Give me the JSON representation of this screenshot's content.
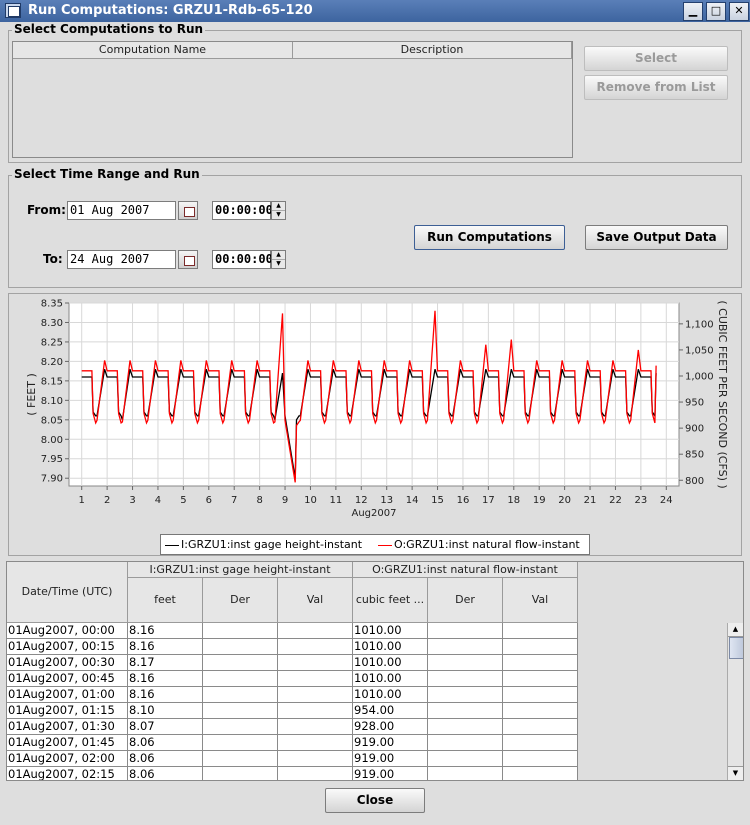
{
  "window": {
    "title": "Run Computations: GRZU1-Rdb-65-120",
    "minimize_glyph": "▁",
    "maximize_glyph": "□",
    "close_glyph": "✕"
  },
  "select_section": {
    "legend": "Select Computations to Run",
    "columns": [
      "Computation Name",
      "Description"
    ],
    "select_button": "Select",
    "remove_button": "Remove from List"
  },
  "time_section": {
    "legend": "Select Time Range and Run",
    "from_label": "From:",
    "from_date": "01 Aug 2007",
    "from_time": "00:00:00",
    "to_label": "To:",
    "to_date": "24 Aug 2007",
    "to_time": "00:00:00",
    "run_button": "Run Computations",
    "save_button": "Save Output Data"
  },
  "chart_data": {
    "type": "line",
    "title": "",
    "xlabel": "Aug2007",
    "ylabel": "( FEET )",
    "y2label": "( CUBIC FEET PER SECOND (CFS) )",
    "x_ticks": [
      "1",
      "2",
      "3",
      "4",
      "5",
      "6",
      "7",
      "8",
      "9",
      "10",
      "11",
      "12",
      "13",
      "14",
      "15",
      "16",
      "17",
      "18",
      "19",
      "20",
      "21",
      "22",
      "23",
      "24"
    ],
    "xlim": [
      0.5,
      24.5
    ],
    "ylim": [
      7.88,
      8.35
    ],
    "y_ticks": [
      "7.90",
      "7.95",
      "8.00",
      "8.05",
      "8.10",
      "8.15",
      "8.20",
      "8.25",
      "8.30",
      "8.35"
    ],
    "y2lim": [
      789,
      1140
    ],
    "y2_ticks": [
      "800",
      "850",
      "900",
      "950",
      "1,000",
      "1,050",
      "1,100"
    ],
    "grid": true,
    "legend_position": "bottom",
    "series": [
      {
        "name": "I:GRZU1:inst gage height-instant",
        "color": "#000000",
        "axis": "left",
        "x": [
          1.0,
          1.4,
          1.45,
          1.55,
          1.6,
          1.9,
          2.0,
          2.4,
          2.45,
          2.55,
          2.6,
          2.9,
          3.0,
          3.4,
          3.45,
          3.55,
          3.6,
          3.9,
          4.0,
          4.4,
          4.45,
          4.55,
          4.6,
          4.9,
          5.0,
          5.4,
          5.45,
          5.55,
          5.6,
          5.9,
          6.0,
          6.4,
          6.45,
          6.55,
          6.6,
          6.9,
          7.0,
          7.4,
          7.45,
          7.55,
          7.6,
          7.9,
          8.0,
          8.4,
          8.45,
          8.55,
          8.6,
          8.9,
          9.0,
          9.4,
          9.45,
          9.55,
          9.6,
          9.9,
          10.0,
          10.4,
          10.45,
          10.55,
          10.6,
          10.9,
          11.0,
          11.4,
          11.45,
          11.55,
          11.6,
          11.9,
          12.0,
          12.4,
          12.45,
          12.55,
          12.6,
          12.9,
          13.0,
          13.4,
          13.45,
          13.55,
          13.6,
          13.9,
          14.0,
          14.4,
          14.45,
          14.55,
          14.6,
          14.9,
          15.0,
          15.4,
          15.45,
          15.55,
          15.6,
          15.9,
          16.0,
          16.4,
          16.45,
          16.55,
          16.6,
          16.9,
          17.0,
          17.4,
          17.45,
          17.55,
          17.6,
          17.9,
          18.0,
          18.4,
          18.45,
          18.55,
          18.6,
          18.9,
          19.0,
          19.4,
          19.45,
          19.55,
          19.6,
          19.9,
          20.0,
          20.4,
          20.45,
          20.55,
          20.6,
          20.9,
          21.0,
          21.4,
          21.45,
          21.55,
          21.6,
          21.9,
          22.0,
          22.4,
          22.45,
          22.55,
          22.6,
          22.9,
          23.0,
          23.4,
          23.45,
          23.55,
          23.6
        ],
        "y": [
          8.16,
          8.16,
          8.07,
          8.06,
          8.06,
          8.18,
          8.16,
          8.16,
          8.07,
          8.06,
          8.05,
          8.18,
          8.16,
          8.16,
          8.07,
          8.06,
          8.06,
          8.18,
          8.16,
          8.16,
          8.07,
          8.06,
          8.06,
          8.18,
          8.16,
          8.16,
          8.07,
          8.06,
          8.06,
          8.18,
          8.16,
          8.16,
          8.07,
          8.06,
          8.06,
          8.18,
          8.16,
          8.16,
          8.07,
          8.06,
          8.06,
          8.18,
          8.16,
          8.16,
          8.07,
          8.06,
          8.05,
          8.17,
          8.06,
          7.9,
          8.05,
          8.06,
          8.06,
          8.18,
          8.16,
          8.16,
          8.07,
          8.06,
          8.06,
          8.18,
          8.16,
          8.16,
          8.07,
          8.06,
          8.06,
          8.18,
          8.16,
          8.16,
          8.07,
          8.06,
          8.06,
          8.18,
          8.16,
          8.16,
          8.07,
          8.06,
          8.06,
          8.18,
          8.16,
          8.16,
          8.07,
          8.06,
          8.06,
          8.18,
          8.16,
          8.16,
          8.07,
          8.06,
          8.06,
          8.18,
          8.16,
          8.16,
          8.07,
          8.06,
          8.06,
          8.18,
          8.16,
          8.16,
          8.07,
          8.06,
          8.06,
          8.18,
          8.16,
          8.16,
          8.07,
          8.06,
          8.06,
          8.18,
          8.16,
          8.16,
          8.07,
          8.06,
          8.06,
          8.18,
          8.16,
          8.16,
          8.07,
          8.06,
          8.06,
          8.18,
          8.16,
          8.16,
          8.07,
          8.06,
          8.06,
          8.18,
          8.16,
          8.16,
          8.07,
          8.06,
          8.06,
          8.18,
          8.16,
          8.16,
          8.07,
          8.06,
          8.17
        ]
      },
      {
        "name": "O:GRZU1:inst natural flow-instant",
        "color": "#ff0000",
        "axis": "right",
        "x": [
          1.0,
          1.4,
          1.45,
          1.55,
          1.6,
          1.9,
          2.0,
          2.4,
          2.45,
          2.55,
          2.6,
          2.9,
          3.0,
          3.4,
          3.45,
          3.55,
          3.6,
          3.9,
          4.0,
          4.4,
          4.45,
          4.55,
          4.6,
          4.9,
          5.0,
          5.4,
          5.45,
          5.55,
          5.6,
          5.9,
          6.0,
          6.4,
          6.45,
          6.55,
          6.6,
          6.9,
          7.0,
          7.4,
          7.45,
          7.55,
          7.6,
          7.9,
          8.0,
          8.4,
          8.45,
          8.55,
          8.6,
          8.9,
          9.0,
          9.4,
          9.45,
          9.55,
          9.6,
          9.9,
          10.0,
          10.4,
          10.45,
          10.55,
          10.6,
          10.9,
          11.0,
          11.4,
          11.45,
          11.55,
          11.6,
          11.9,
          12.0,
          12.4,
          12.45,
          12.55,
          12.6,
          12.9,
          13.0,
          13.4,
          13.45,
          13.55,
          13.6,
          13.9,
          14.0,
          14.4,
          14.45,
          14.55,
          14.6,
          14.9,
          15.0,
          15.4,
          15.45,
          15.55,
          15.6,
          15.9,
          16.0,
          16.4,
          16.45,
          16.55,
          16.6,
          16.9,
          17.0,
          17.4,
          17.45,
          17.55,
          17.6,
          17.9,
          18.0,
          18.4,
          18.45,
          18.55,
          18.6,
          18.9,
          19.0,
          19.4,
          19.45,
          19.55,
          19.6,
          19.9,
          20.0,
          20.4,
          20.45,
          20.55,
          20.6,
          20.9,
          21.0,
          21.4,
          21.45,
          21.55,
          21.6,
          21.9,
          22.0,
          22.4,
          22.45,
          22.55,
          22.6,
          22.9,
          23.0,
          23.4,
          23.45,
          23.55,
          23.6
        ],
        "y": [
          1010,
          1010,
          928,
          910,
          915,
          1030,
          1010,
          1010,
          928,
          910,
          912,
          1030,
          1010,
          1010,
          928,
          910,
          915,
          1030,
          1010,
          1010,
          928,
          910,
          915,
          1030,
          1010,
          1010,
          928,
          910,
          915,
          1030,
          1010,
          1010,
          928,
          910,
          915,
          1030,
          1010,
          1010,
          928,
          910,
          915,
          1030,
          1010,
          1010,
          928,
          910,
          912,
          1120,
          915,
          796,
          905,
          912,
          915,
          1030,
          1010,
          1010,
          928,
          910,
          915,
          1030,
          1010,
          1010,
          928,
          910,
          915,
          1030,
          1010,
          1010,
          928,
          910,
          915,
          1030,
          1010,
          1010,
          928,
          910,
          915,
          1030,
          1010,
          1010,
          928,
          910,
          915,
          1125,
          1010,
          1010,
          928,
          910,
          915,
          1030,
          1010,
          1010,
          928,
          910,
          915,
          1060,
          1010,
          1010,
          928,
          910,
          915,
          1070,
          1010,
          1010,
          928,
          910,
          915,
          1030,
          1010,
          1010,
          928,
          910,
          915,
          1030,
          1010,
          1010,
          928,
          910,
          915,
          1030,
          1010,
          1010,
          928,
          910,
          915,
          1030,
          1010,
          1010,
          928,
          910,
          915,
          1050,
          1010,
          1010,
          928,
          910,
          1020
        ]
      }
    ]
  },
  "legend": {
    "series1": "I:GRZU1:inst gage height-instant",
    "series2": "O:GRZU1:inst natural flow-instant"
  },
  "table": {
    "datetime_header": "Date/Time (UTC)",
    "group1": "I:GRZU1:inst gage height-instant",
    "group2": "O:GRZU1:inst natural flow-instant",
    "sub_headers": [
      "feet",
      "Der",
      "Val",
      "cubic feet ...",
      "Der",
      "Val"
    ],
    "rows": [
      [
        "01Aug2007, 00:00",
        "8.16",
        "",
        "",
        "1010.00",
        "",
        ""
      ],
      [
        "01Aug2007, 00:15",
        "8.16",
        "",
        "",
        "1010.00",
        "",
        ""
      ],
      [
        "01Aug2007, 00:30",
        "8.17",
        "",
        "",
        "1010.00",
        "",
        ""
      ],
      [
        "01Aug2007, 00:45",
        "8.16",
        "",
        "",
        "1010.00",
        "",
        ""
      ],
      [
        "01Aug2007, 01:00",
        "8.16",
        "",
        "",
        "1010.00",
        "",
        ""
      ],
      [
        "01Aug2007, 01:15",
        "8.10",
        "",
        "",
        "954.00",
        "",
        ""
      ],
      [
        "01Aug2007, 01:30",
        "8.07",
        "",
        "",
        "928.00",
        "",
        ""
      ],
      [
        "01Aug2007, 01:45",
        "8.06",
        "",
        "",
        "919.00",
        "",
        ""
      ],
      [
        "01Aug2007, 02:00",
        "8.06",
        "",
        "",
        "919.00",
        "",
        ""
      ],
      [
        "01Aug2007, 02:15",
        "8.06",
        "",
        "",
        "919.00",
        "",
        ""
      ]
    ]
  },
  "footer": {
    "close_button": "Close"
  }
}
